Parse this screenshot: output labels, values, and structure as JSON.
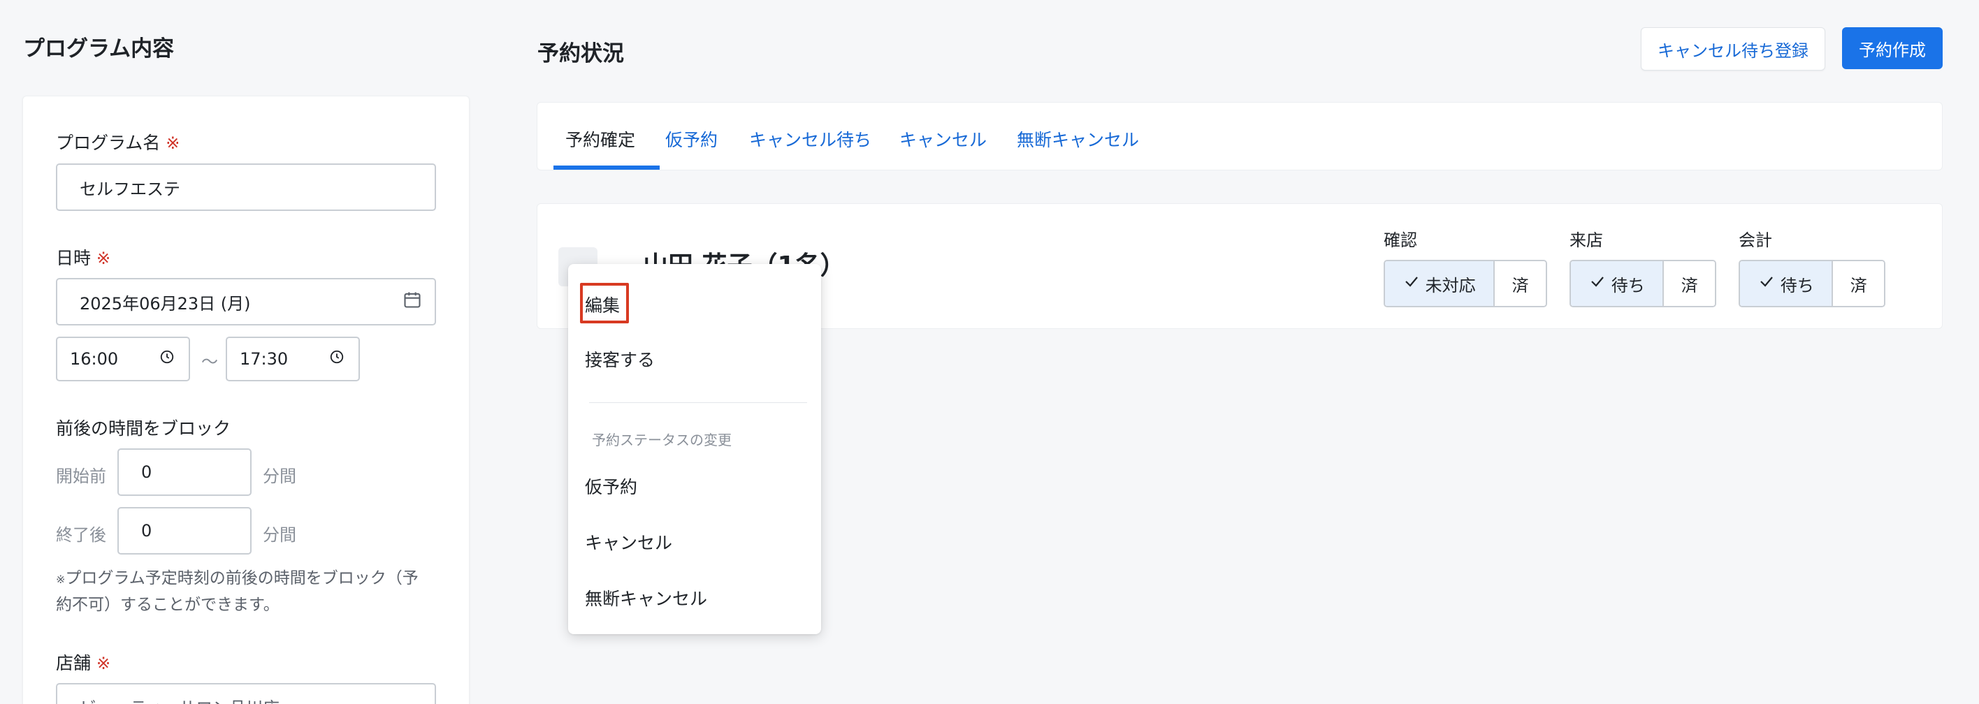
{
  "left": {
    "title": "プログラム内容",
    "program_name_label": "プログラム名",
    "required_mark": "※",
    "program_name_value": "セルフエステ",
    "datetime_label": "日時",
    "date_value": "2025年06月23日 (月)",
    "start_time": "16:00",
    "end_time": "17:30",
    "time_separator": "～",
    "block_label": "前後の時間をブロック",
    "before_label": "開始前",
    "before_value": "0",
    "after_label": "終了後",
    "after_value": "0",
    "unit_minutes": "分間",
    "note_mark": "※",
    "note_line1": "プログラム予定時刻の前後の時間をブロック（予",
    "note_line2": "約不可）することができます。",
    "store_label": "店舗",
    "store_value": "ビューティーサロン品川店"
  },
  "right": {
    "title": "予約状況",
    "waitlist_button": "キャンセル待ち登録",
    "create_button": "予約作成",
    "tabs": [
      {
        "label": "予約確定",
        "active": true
      },
      {
        "label": "仮予約",
        "active": false
      },
      {
        "label": "キャンセル待ち",
        "active": false
      },
      {
        "label": "キャンセル",
        "active": false
      },
      {
        "label": "無断キャンセル",
        "active": false
      }
    ],
    "reservation": {
      "name": "山田 花子（1名）",
      "statuses": [
        {
          "label": "確認",
          "pending": "未対応",
          "done": "済"
        },
        {
          "label": "来店",
          "pending": "待ち",
          "done": "済"
        },
        {
          "label": "会計",
          "pending": "待ち",
          "done": "済"
        }
      ]
    }
  },
  "menu": {
    "edit": "編集",
    "serve": "接客する",
    "status_header": "予約ステータスの変更",
    "items": [
      "仮予約",
      "キャンセル",
      "無断キャンセル"
    ]
  },
  "colors": {
    "accent": "#1a73e8",
    "link": "#1769d6",
    "required": "#d0352a",
    "highlight": "#d83a22"
  }
}
